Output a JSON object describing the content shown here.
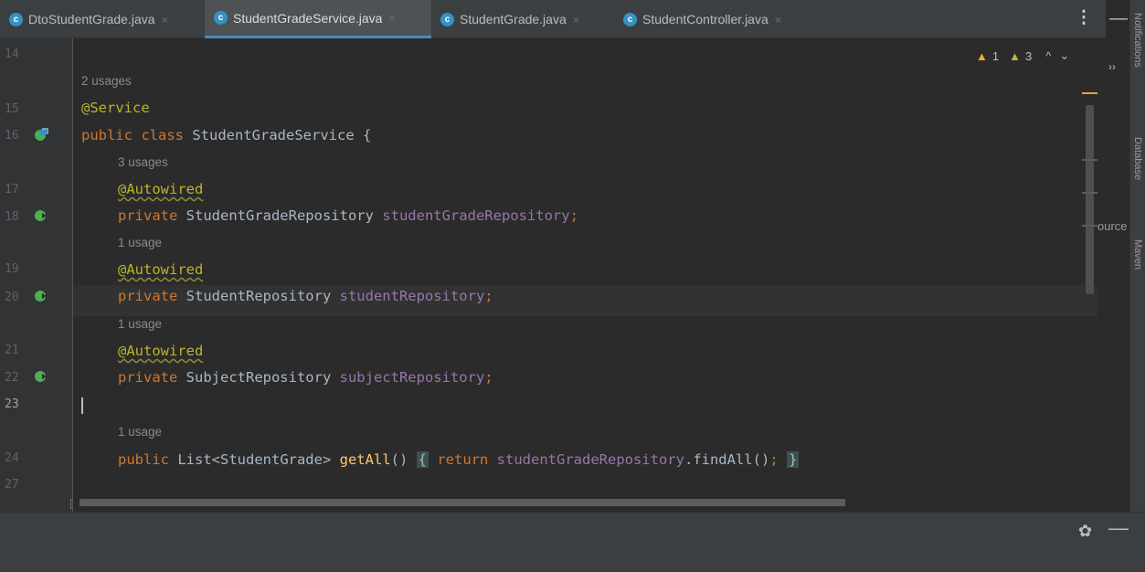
{
  "tabs": [
    {
      "label": "DtoStudentGrade.java",
      "active": false
    },
    {
      "label": "StudentGradeService.java",
      "active": true
    },
    {
      "label": "StudentGrade.java",
      "active": false
    },
    {
      "label": "StudentController.java",
      "active": false
    }
  ],
  "tab_close_glyph": "×",
  "tab_icon_letter": "c",
  "more_tabs_glyph": "⋮",
  "minimize_glyph": "—",
  "right_panel_labels": {
    "notifications": "Notifications",
    "database": "Database",
    "maven": "Maven"
  },
  "right_panel_fragment": "ource",
  "chevron_glyph": "››",
  "inspections": {
    "warnings": "1",
    "weak_warnings": "3",
    "warning_icon": "warning-triangle",
    "weak_icon": "weak-warning-triangle",
    "up": "^",
    "down": "⌄"
  },
  "line_numbers": {
    "l14": "14",
    "l15": "15",
    "l16": "16",
    "l17": "17",
    "l18": "18",
    "l19": "19",
    "l20": "20",
    "l21": "21",
    "l22": "22",
    "l23": "23",
    "l24": "24",
    "l27": "27"
  },
  "hints": {
    "h1": "2 usages",
    "h2": "3 usages",
    "h3": "1 usage",
    "h4": "1 usage",
    "h5": "1 usage"
  },
  "code": {
    "service_ann": "@Service",
    "public": "public",
    "class": "class",
    "class_name": " StudentGradeService {",
    "autowired": "@Autowired",
    "private": "private",
    "type1": " StudentGradeRepository ",
    "field1": "studentGradeRepository",
    "type2": " StudentRepository ",
    "field2": "studentRepository",
    "type3": " SubjectRepository ",
    "field3": "subjectRepository",
    "semicolon": ";",
    "method_type": " List<StudentGrade> ",
    "method_name": "getAll",
    "method_parens": "() ",
    "open_brace": "{",
    "return": "return",
    "ret_field": "studentGradeRepository",
    "ret_call": ".findAll()",
    "close_brace": "}"
  },
  "fold_glyph": "⊟",
  "gear_glyph": "✿",
  "colors": {
    "accent": "#4a88c7",
    "keyword": "#cc7832",
    "annotation": "#bbb529",
    "field": "#9876aa",
    "method": "#ffc66d",
    "text": "#a9b7c6",
    "background": "#2b2b2b",
    "bean_icon": "#4caf50"
  }
}
